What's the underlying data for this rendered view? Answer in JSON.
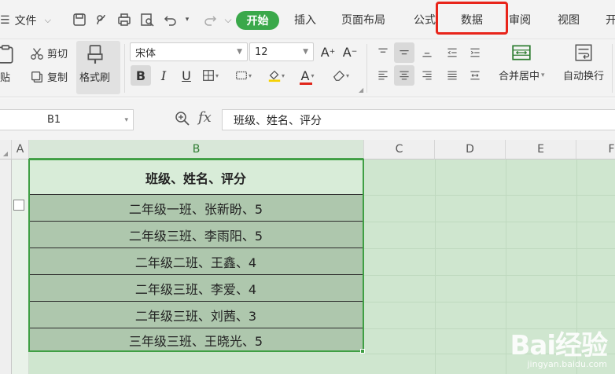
{
  "menu": {
    "file_label": "文件",
    "tabs": {
      "start": "开始",
      "insert": "插入",
      "page_layout": "页面布局",
      "formula": "公式",
      "data": "数据",
      "review": "审阅",
      "view": "视图",
      "more": "开"
    },
    "highlight_color": "#e8241a",
    "accent_color": "#3aa84a"
  },
  "ribbon": {
    "paste_label": "粘贴",
    "cut_label": "剪切",
    "copy_label": "复制",
    "format_painter_label": "格式刷",
    "font_name": "宋体",
    "font_size": "12",
    "merge_center_label": "合并居中",
    "wrap_text_label": "自动换行"
  },
  "formula_bar": {
    "cell_ref": "B1",
    "fx_label": "fx",
    "content": "班级、姓名、评分"
  },
  "sheet": {
    "columns": [
      "A",
      "B",
      "C",
      "D",
      "E",
      "F"
    ],
    "active_column": "B",
    "rows": [
      "班级、姓名、评分",
      "二年级一班、张新盼、5",
      "二年级三班、李雨阳、5",
      "二年级二班、王鑫、4",
      "二年级三班、李爱、4",
      "二年级三班、刘茜、3",
      "三年级三班、王晓光、5"
    ]
  },
  "watermark": {
    "brand": "Bai经验",
    "url": "jingyan.baidu.com"
  }
}
